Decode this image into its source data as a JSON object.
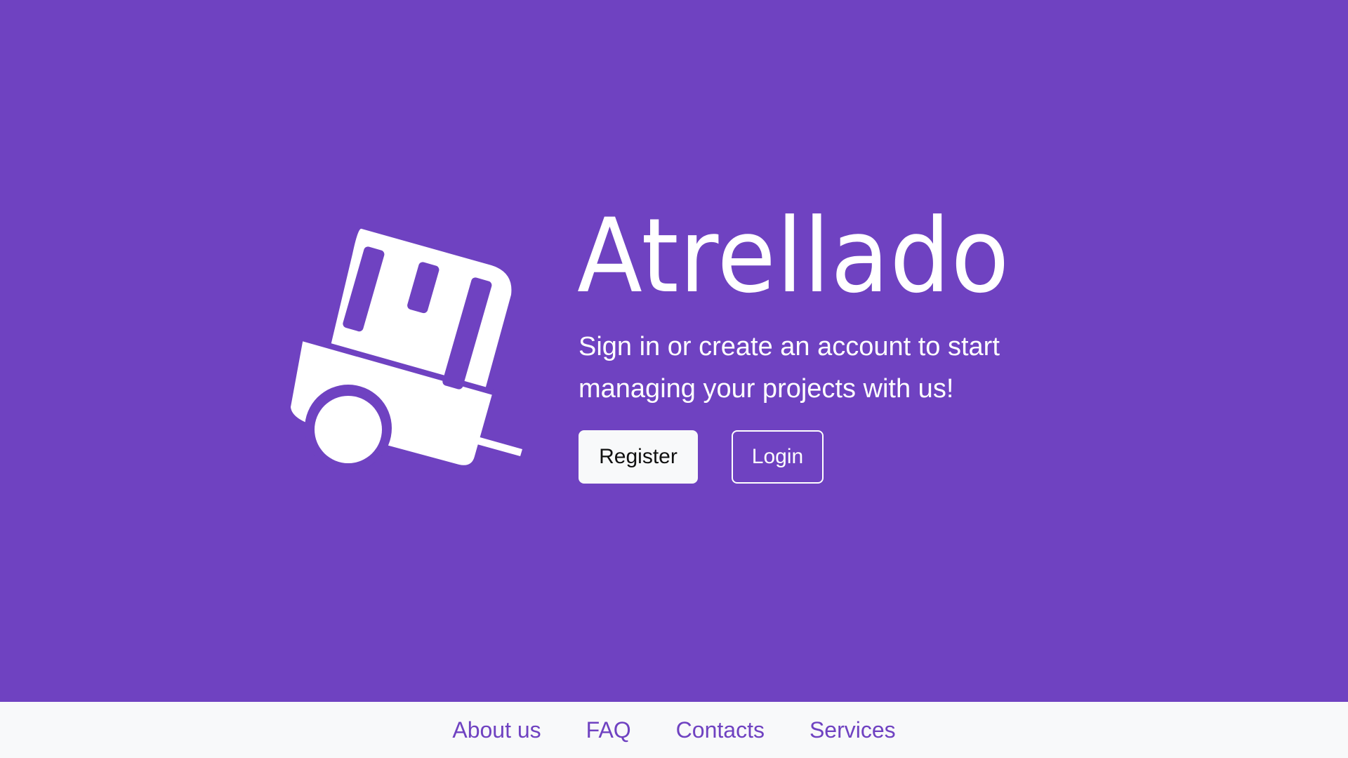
{
  "colors": {
    "brand": "#6f42c1",
    "light": "#f8f9fa",
    "text_on_brand": "#ffffff"
  },
  "hero": {
    "logo_icon": "cart-board-icon",
    "title": "Atrellado",
    "subtitle": "Sign in or create an account to start managing your projects with us!",
    "register_label": "Register",
    "login_label": "Login"
  },
  "footer": {
    "links": [
      "About us",
      "FAQ",
      "Contacts",
      "Services"
    ]
  }
}
